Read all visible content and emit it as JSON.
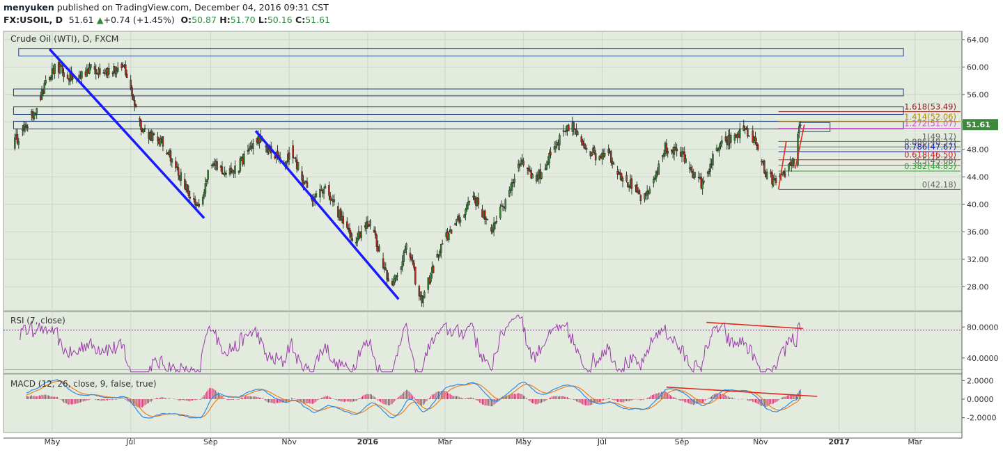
{
  "header": {
    "author": "menyuken",
    "published_text": "published on TradingView.com, December 04, 2016 09:31 CST",
    "symbol": "FX:USOIL, D",
    "last": "51.61",
    "change": "+0.74 (+1.45%)",
    "o_label": "O:",
    "o": "50.87",
    "h_label": "H:",
    "h": "51.70",
    "l_label": "L:",
    "l": "50.16",
    "c_label": "C:",
    "c": "51.61"
  },
  "colors": {
    "panel_bg": "#e2ebde",
    "candle_up": "#3d8a3d",
    "candle_down": "#b82a24",
    "trendline": "#1a1aff",
    "zone_border": "#1e3c82",
    "rsi_line": "#9a3aa9",
    "macd_line": "#2e8be6",
    "signal_line": "#f07d1e",
    "hist": "#c62d64",
    "divergence": "#e02a1a"
  },
  "chart_data": [
    {
      "type": "candlestick",
      "title": "Crude Oil (WTI), D, FXCM",
      "ylim": [
        24.5,
        65.2
      ],
      "y_ticks": [
        "64.00",
        "60.00",
        "56.00",
        "52.00",
        "48.00",
        "44.00",
        "40.00",
        "36.00",
        "32.00",
        "28.00"
      ],
      "last_price_label": "51.61",
      "x_tick_labels": [
        "May",
        "Jul",
        "Sep",
        "Nov",
        "2016",
        "Mar",
        "May",
        "Jul",
        "Sep",
        "Nov",
        "2017",
        "Mar"
      ],
      "price_anchors": [
        {
          "t": "2015-04-01",
          "p": 48.5
        },
        {
          "t": "2015-05-05",
          "p": 60.0
        },
        {
          "t": "2015-05-20",
          "p": 58.5
        },
        {
          "t": "2015-06-12",
          "p": 60.0
        },
        {
          "t": "2015-06-26",
          "p": 59.5
        },
        {
          "t": "2015-07-08",
          "p": 52.0
        },
        {
          "t": "2015-07-22",
          "p": 49.5
        },
        {
          "t": "2015-08-10",
          "p": 44.0
        },
        {
          "t": "2015-08-24",
          "p": 38.5
        },
        {
          "t": "2015-09-01",
          "p": 46.0
        },
        {
          "t": "2015-09-22",
          "p": 45.0
        },
        {
          "t": "2015-10-09",
          "p": 50.0
        },
        {
          "t": "2015-10-28",
          "p": 45.5
        },
        {
          "t": "2015-11-03",
          "p": 47.5
        },
        {
          "t": "2015-11-20",
          "p": 41.0
        },
        {
          "t": "2015-11-30",
          "p": 42.0
        },
        {
          "t": "2015-12-22",
          "p": 35.0
        },
        {
          "t": "2016-01-04",
          "p": 37.0
        },
        {
          "t": "2016-01-20",
          "p": 28.0
        },
        {
          "t": "2016-02-01",
          "p": 33.5
        },
        {
          "t": "2016-02-11",
          "p": 26.5
        },
        {
          "t": "2016-03-01",
          "p": 34.5
        },
        {
          "t": "2016-03-22",
          "p": 41.5
        },
        {
          "t": "2016-04-05",
          "p": 36.0
        },
        {
          "t": "2016-04-29",
          "p": 46.0
        },
        {
          "t": "2016-05-10",
          "p": 44.0
        },
        {
          "t": "2016-06-08",
          "p": 51.5
        },
        {
          "t": "2016-06-27",
          "p": 46.5
        },
        {
          "t": "2016-07-06",
          "p": 47.5
        },
        {
          "t": "2016-08-02",
          "p": 40.0
        },
        {
          "t": "2016-08-19",
          "p": 48.5
        },
        {
          "t": "2016-08-30",
          "p": 47.0
        },
        {
          "t": "2016-09-08",
          "p": 45.5
        },
        {
          "t": "2016-09-16",
          "p": 43.5
        },
        {
          "t": "2016-09-30",
          "p": 48.0
        },
        {
          "t": "2016-10-19",
          "p": 51.5
        },
        {
          "t": "2016-10-26",
          "p": 49.5
        },
        {
          "t": "2016-11-04",
          "p": 44.5
        },
        {
          "t": "2016-11-14",
          "p": 43.5
        },
        {
          "t": "2016-11-25",
          "p": 46.0
        },
        {
          "t": "2016-11-29",
          "p": 45.5
        },
        {
          "t": "2016-11-30",
          "p": 49.5
        },
        {
          "t": "2016-12-02",
          "p": 51.6
        }
      ],
      "zones": [
        {
          "y1": 61.6,
          "y2": 62.7,
          "x1": "2015-04-05",
          "x2": "2017-02-20"
        },
        {
          "y1": 55.8,
          "y2": 56.8,
          "x1": "2015-04-01",
          "x2": "2017-02-20"
        },
        {
          "y1": 53.1,
          "y2": 54.2,
          "x1": "2015-04-01",
          "x2": "2017-02-20"
        },
        {
          "y1": 51.0,
          "y2": 52.1,
          "x1": "2015-04-01",
          "x2": "2017-02-20"
        },
        {
          "y1": 50.6,
          "y2": 51.9,
          "x1": "2016-12-01",
          "x2": "2016-12-25"
        }
      ],
      "trendlines": [
        {
          "t1": "2015-04-29",
          "p1": 62.6,
          "t2": "2015-08-27",
          "p2": 38.0
        },
        {
          "t1": "2015-10-06",
          "p1": 50.7,
          "t2": "2016-01-25",
          "p2": 26.2
        }
      ],
      "red_lines": [
        {
          "t1": "2016-11-15",
          "p1": 42.2,
          "t2": "2016-11-21",
          "p2": 49.2
        },
        {
          "t1": "2016-11-28",
          "p1": 45.2,
          "t2": "2016-12-05",
          "p2": 51.6
        }
      ],
      "fibonacci": [
        {
          "label": "1.618(53.49)",
          "value": 53.49,
          "color": "#8b1a1a"
        },
        {
          "label": "1.414(52.06)",
          "value": 52.06,
          "color": "#b8860b"
        },
        {
          "label": "1.272(51.07)",
          "value": 51.07,
          "color": "#d64fd6"
        },
        {
          "label": "1(49.17)",
          "value": 49.17,
          "color": "#666666"
        },
        {
          "label": "0.886(48.37)",
          "value": 48.37,
          "color": "#666666"
        },
        {
          "label": "0.786(47.67)",
          "value": 47.67,
          "color": "#1a1ab0"
        },
        {
          "label": "0.618(46.50)",
          "value": 46.5,
          "color": "#c81e1e"
        },
        {
          "label": "0.5(45.68)",
          "value": 45.68,
          "color": "#666666"
        },
        {
          "label": "0.382(44.85)",
          "value": 44.85,
          "color": "#2ca02c"
        },
        {
          "label": "0(42.18)",
          "value": 42.18,
          "color": "#666666"
        }
      ]
    },
    {
      "type": "line",
      "title": "RSI (7, close)",
      "ylim": [
        20,
        100
      ],
      "y_ticks": [
        "80.0000",
        "40.0000"
      ],
      "last_value": 76.0
    },
    {
      "type": "line",
      "title": "MACD (12, 26, close, 9, false, true)",
      "ylim": [
        -3.6,
        2.7
      ],
      "y_ticks": [
        "2.0000",
        "0.0000",
        "-2.0000"
      ],
      "series": [
        {
          "name": "MACD"
        },
        {
          "name": "Signal"
        },
        {
          "name": "Histogram"
        }
      ]
    }
  ]
}
